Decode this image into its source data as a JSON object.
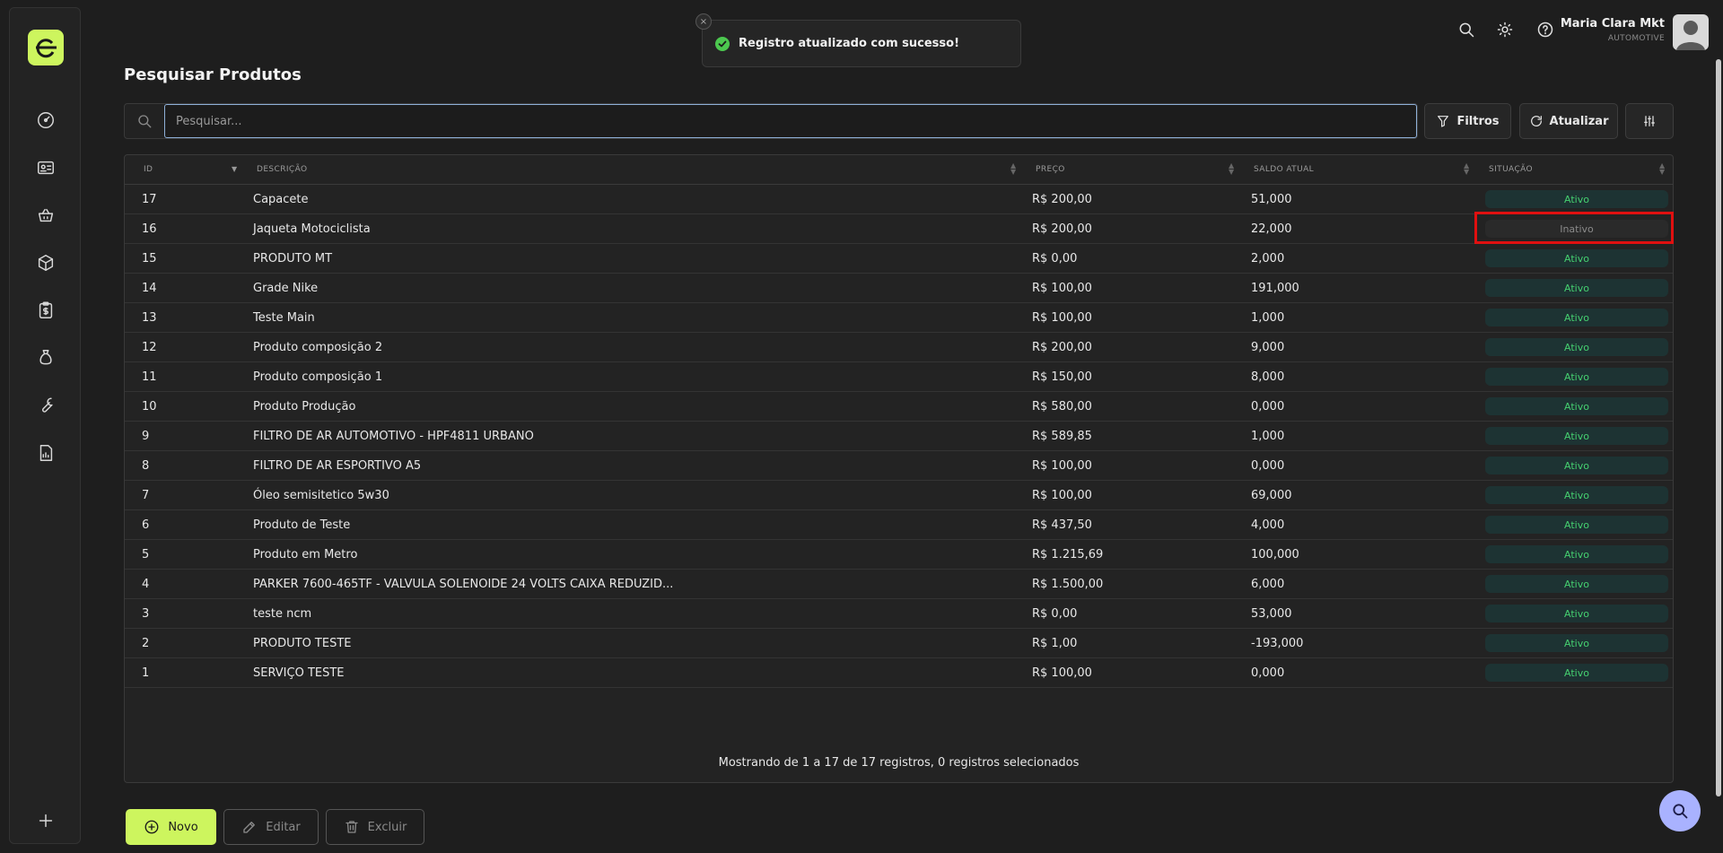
{
  "toast": {
    "message": "Registro atualizado com sucesso!",
    "close": "×"
  },
  "user": {
    "name": "Maria Clara Mkt",
    "org": "AUTOMOTIVE"
  },
  "page": {
    "title": "Pesquisar Produtos"
  },
  "search": {
    "placeholder": "Pesquisar..."
  },
  "toolbar": {
    "filters_label": "Filtros",
    "refresh_label": "Atualizar"
  },
  "table": {
    "columns": {
      "id": "ID",
      "desc": "DESCRIÇÃO",
      "price": "PREÇO",
      "balance": "SALDO ATUAL",
      "status": "SITUAÇÃO"
    },
    "rows": [
      {
        "id": "17",
        "desc": "Capacete",
        "price": "R$ 200,00",
        "balance": "51,000",
        "status": "Ativo"
      },
      {
        "id": "16",
        "desc": "Jaqueta Motociclista",
        "price": "R$ 200,00",
        "balance": "22,000",
        "status": "Inativo"
      },
      {
        "id": "15",
        "desc": "PRODUTO MT",
        "price": "R$ 0,00",
        "balance": "2,000",
        "status": "Ativo"
      },
      {
        "id": "14",
        "desc": "Grade Nike",
        "price": "R$ 100,00",
        "balance": "191,000",
        "status": "Ativo"
      },
      {
        "id": "13",
        "desc": "Teste Main",
        "price": "R$ 100,00",
        "balance": "1,000",
        "status": "Ativo"
      },
      {
        "id": "12",
        "desc": "Produto composição 2",
        "price": "R$ 200,00",
        "balance": "9,000",
        "status": "Ativo"
      },
      {
        "id": "11",
        "desc": "Produto composição 1",
        "price": "R$ 150,00",
        "balance": "8,000",
        "status": "Ativo"
      },
      {
        "id": "10",
        "desc": "Produto Produção",
        "price": "R$ 580,00",
        "balance": "0,000",
        "status": "Ativo"
      },
      {
        "id": "9",
        "desc": "FILTRO DE AR AUTOMOTIVO - HPF4811 URBANO",
        "price": "R$ 589,85",
        "balance": "1,000",
        "status": "Ativo"
      },
      {
        "id": "8",
        "desc": "FILTRO DE AR ESPORTIVO A5",
        "price": "R$ 100,00",
        "balance": "0,000",
        "status": "Ativo"
      },
      {
        "id": "7",
        "desc": "Óleo semisitetico 5w30",
        "price": "R$ 100,00",
        "balance": "69,000",
        "status": "Ativo"
      },
      {
        "id": "6",
        "desc": "Produto de Teste",
        "price": "R$ 437,50",
        "balance": "4,000",
        "status": "Ativo"
      },
      {
        "id": "5",
        "desc": "Produto em Metro",
        "price": "R$ 1.215,69",
        "balance": "100,000",
        "status": "Ativo"
      },
      {
        "id": "4",
        "desc": "PARKER 7600-465TF - VALVULA SOLENOIDE 24 VOLTS CAIXA REDUZID...",
        "price": "R$ 1.500,00",
        "balance": "6,000",
        "status": "Ativo"
      },
      {
        "id": "3",
        "desc": "teste ncm",
        "price": "R$ 0,00",
        "balance": "53,000",
        "status": "Ativo"
      },
      {
        "id": "2",
        "desc": "PRODUTO TESTE",
        "price": "R$ 1,00",
        "balance": "-193,000",
        "status": "Ativo"
      },
      {
        "id": "1",
        "desc": "SERVIÇO TESTE",
        "price": "R$ 100,00",
        "balance": "0,000",
        "status": "Ativo"
      }
    ],
    "footer": "Mostrando de 1 a 17 de 17 registros, 0 registros selecionados"
  },
  "actions": {
    "new_label": "Novo",
    "edit_label": "Editar",
    "delete_label": "Excluir"
  },
  "colors": {
    "accent": "#cdf55e",
    "active_text": "#45d070",
    "highlight": "#e01010",
    "fab": "#a9b2ff"
  },
  "icons": [
    "dashboard-icon",
    "id-card-icon",
    "basket-icon",
    "box-icon",
    "clipboard-dollar-icon",
    "money-bag-icon",
    "wrench-icon",
    "report-icon",
    "plus-icon",
    "search-icon",
    "sun-icon",
    "help-icon"
  ]
}
